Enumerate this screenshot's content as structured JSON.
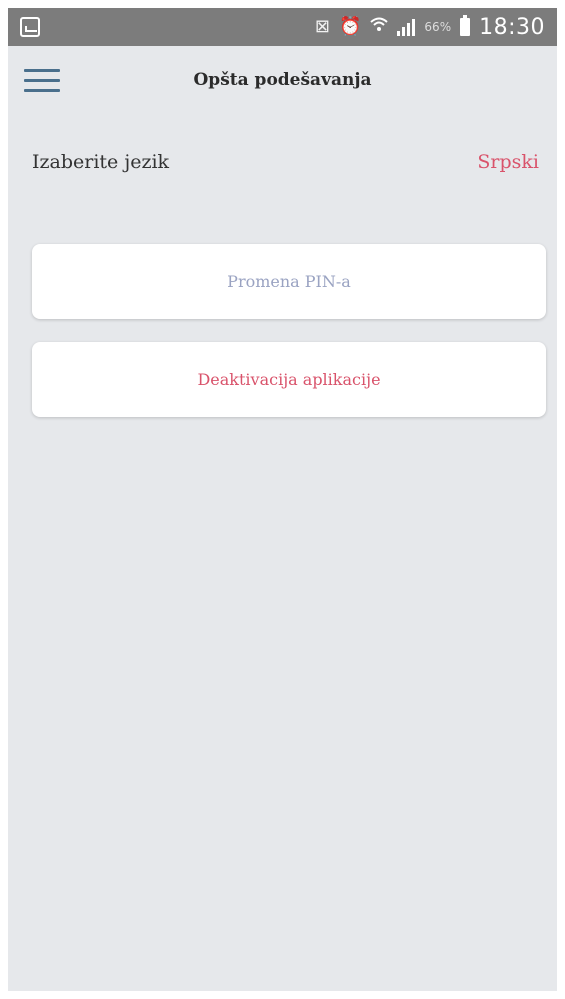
{
  "status_bar": {
    "notification_icons": [
      "image-icon",
      "mute-icon",
      "alarm-icon",
      "wifi-icon",
      "signal-icon"
    ],
    "battery_percent": "66%",
    "time": "18:30"
  },
  "header": {
    "title": "Opšta podešavanja",
    "menu_icon": "hamburger-menu-icon"
  },
  "language": {
    "label": "Izaberite jezik",
    "value": "Srpski"
  },
  "actions": {
    "change_pin": "Promena PIN-a",
    "deactivate": "Deaktivacija aplikacije"
  },
  "colors": {
    "background": "#e6e8eb",
    "status_bar": "#7c7c7c",
    "accent_red": "#d9536b",
    "muted_blue": "#9aa3c2",
    "menu_icon": "#4a6f8c"
  }
}
